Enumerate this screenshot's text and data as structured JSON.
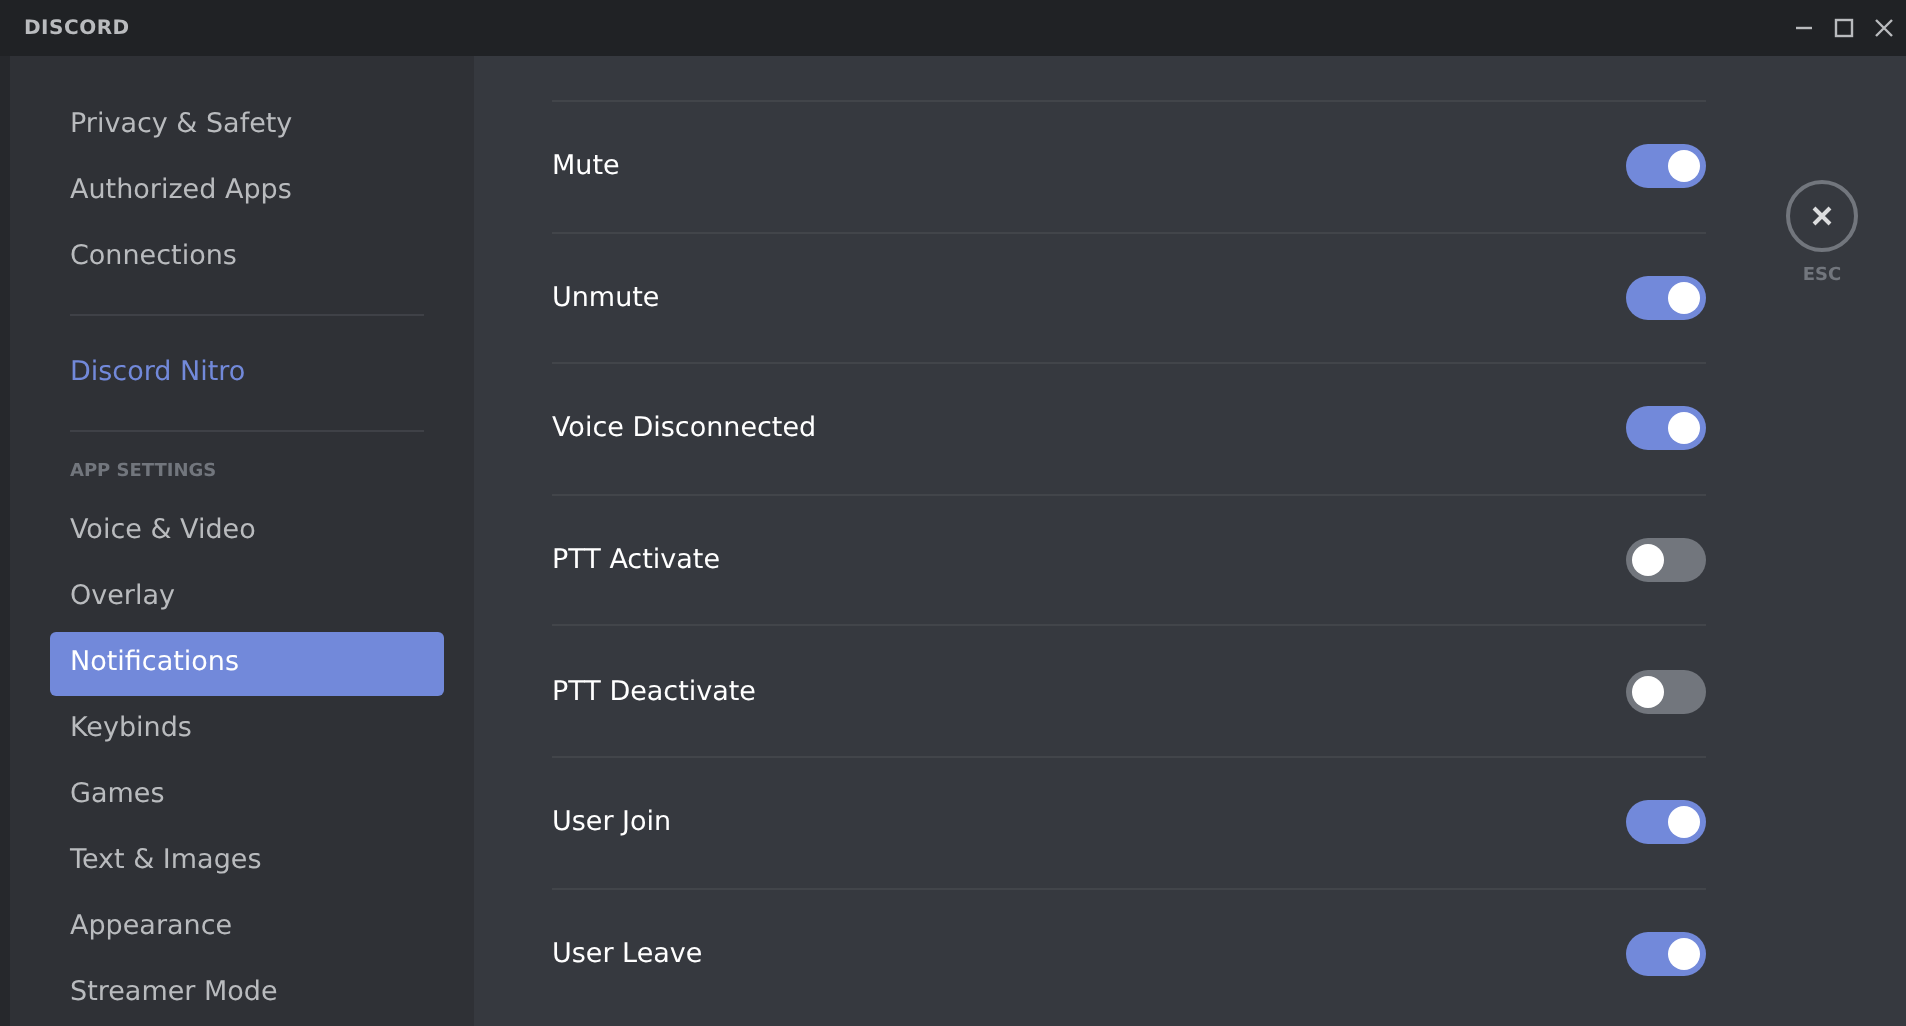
{
  "window": {
    "title": "DISCORD"
  },
  "sidebar": {
    "sections": [
      {
        "items": [
          {
            "label": "Privacy & Safety",
            "selected": false
          },
          {
            "label": "Authorized Apps",
            "selected": false
          },
          {
            "label": "Connections",
            "selected": false
          }
        ]
      },
      {
        "items": [
          {
            "label": "Discord Nitro",
            "selected": false,
            "kind": "nitro"
          }
        ]
      },
      {
        "header": "APP SETTINGS",
        "items": [
          {
            "label": "Voice & Video",
            "selected": false
          },
          {
            "label": "Overlay",
            "selected": false
          },
          {
            "label": "Notifications",
            "selected": true
          },
          {
            "label": "Keybinds",
            "selected": false
          },
          {
            "label": "Games",
            "selected": false
          },
          {
            "label": "Text & Images",
            "selected": false
          },
          {
            "label": "Appearance",
            "selected": false
          },
          {
            "label": "Streamer Mode",
            "selected": false
          }
        ]
      }
    ]
  },
  "sounds": [
    {
      "label": "Mute",
      "on": true
    },
    {
      "label": "Unmute",
      "on": true
    },
    {
      "label": "Voice Disconnected",
      "on": true
    },
    {
      "label": "PTT Activate",
      "on": false
    },
    {
      "label": "PTT Deactivate",
      "on": false
    },
    {
      "label": "User Join",
      "on": true
    },
    {
      "label": "User Leave",
      "on": true
    }
  ],
  "close": {
    "label": "ESC"
  }
}
